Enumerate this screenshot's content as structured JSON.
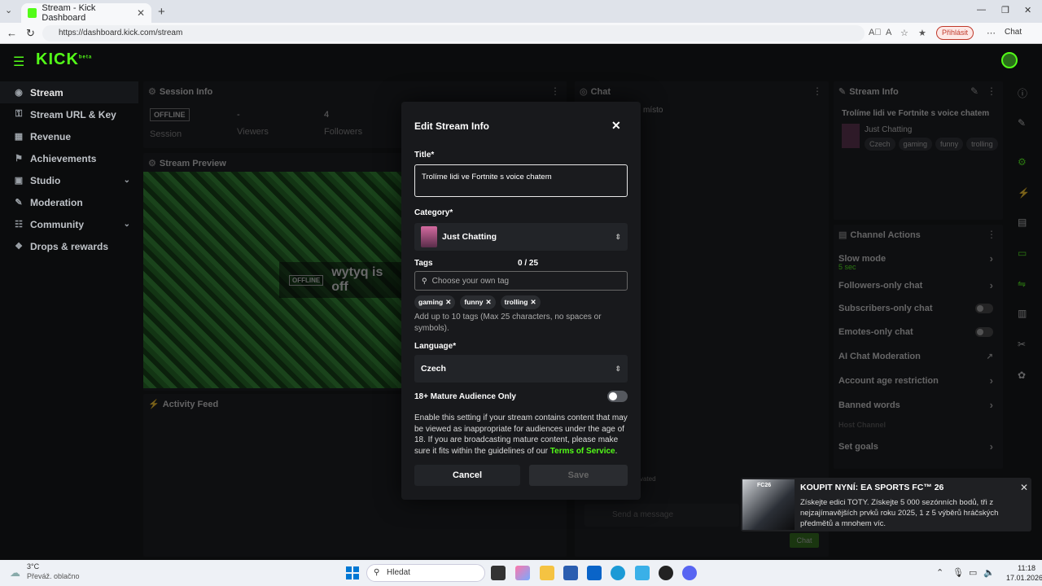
{
  "browser": {
    "tab_title": "Stream - Kick Dashboard",
    "url": "https://dashboard.kick.com/stream",
    "signin_label": "Přihlásit",
    "chat_label": "Chat"
  },
  "app": {
    "logo": "KICK",
    "logo_suffix": "beta"
  },
  "sidebar": {
    "items": [
      {
        "label": "Stream",
        "icon": "broadcast-icon"
      },
      {
        "label": "Stream URL & Key",
        "icon": "key-icon"
      },
      {
        "label": "Revenue",
        "icon": "revenue-icon"
      },
      {
        "label": "Achievements",
        "icon": "trophy-icon"
      },
      {
        "label": "Studio",
        "icon": "studio-icon"
      },
      {
        "label": "Moderation",
        "icon": "wrench-icon"
      },
      {
        "label": "Community",
        "icon": "community-icon"
      },
      {
        "label": "Drops & rewards",
        "icon": "gift-icon"
      }
    ]
  },
  "session": {
    "title": "Session Info",
    "status": "OFFLINE",
    "status_label": "Session",
    "viewers_value": "-",
    "viewers_label": "Viewers",
    "followers_value": "4",
    "followers_label": "Followers"
  },
  "preview": {
    "title": "Stream Preview",
    "offline_badge": "OFFLINE",
    "offline_text": "wytyq is off"
  },
  "activity": {
    "title": "Activity Feed"
  },
  "chat": {
    "title": "Chat",
    "partial_text": "místo",
    "placeholder": "Send a message",
    "send_label": "Chat",
    "partial_label": "vated"
  },
  "stream_info_panel": {
    "title": "Stream Info",
    "stream_title": "Trolíme lidi ve Fortnite s voice chatem",
    "category": "Just Chatting",
    "tags": [
      "Czech",
      "gaming",
      "funny",
      "trolling"
    ]
  },
  "channel_actions": {
    "title": "Channel Actions",
    "items": [
      {
        "label": "Slow mode",
        "sub": "5 sec",
        "control": "arrow"
      },
      {
        "label": "Followers-only chat",
        "control": "arrow"
      },
      {
        "label": "Subscribers-only chat",
        "control": "toggle"
      },
      {
        "label": "Emotes-only chat",
        "control": "toggle"
      },
      {
        "label": "AI Chat Moderation",
        "control": "external"
      },
      {
        "label": "Account age restriction",
        "control": "arrow"
      },
      {
        "label": "Banned words",
        "control": "arrow"
      },
      {
        "label": "Host Channel",
        "control": "none"
      },
      {
        "label": "Set goals",
        "control": "arrow"
      }
    ]
  },
  "modal": {
    "title": "Edit Stream Info",
    "title_label": "Title*",
    "title_value": "Trolíme lidi ve Fortnite s voice chatem",
    "category_label": "Category*",
    "category_value": "Just Chatting",
    "tags_label": "Tags",
    "tags_count": "0 / 25",
    "tags_placeholder": "Choose your own tag",
    "tags": [
      "gaming",
      "funny",
      "trolling"
    ],
    "tags_help": "Add up to 10 tags (Max 25 characters, no spaces or symbols).",
    "language_label": "Language*",
    "language_value": "Czech",
    "mature_label": "18+ Mature Audience Only",
    "mature_on": false,
    "mature_help": "Enable this setting if your stream contains content that may be viewed as inappropriate for audiences under the age of 18. If you are broadcasting mature content, please make sure it fits within the guidelines of our",
    "tos_link": "Terms of Service",
    "tos_end": ".",
    "cancel_label": "Cancel",
    "save_label": "Save"
  },
  "ad": {
    "badge": "FC26",
    "title": "KOUPIT NYNÍ: EA SPORTS FC™ 26",
    "body": "Získejte edici TOTY. Získejte 5 000 sezónních bodů, tři z nejzajímavějších prvků roku 2025, 1 z 5 výběrů hráčských předmětů a mnohem víc."
  },
  "taskbar": {
    "weather_temp": "3°C",
    "weather_desc": "Převáž. oblačno",
    "search_placeholder": "Hledat",
    "time": "11:18",
    "date": "17.01.2026"
  },
  "colors": {
    "accent": "#53fc18",
    "background": "#0b0c0d",
    "panel": "#141517",
    "modal": "#18191c"
  }
}
